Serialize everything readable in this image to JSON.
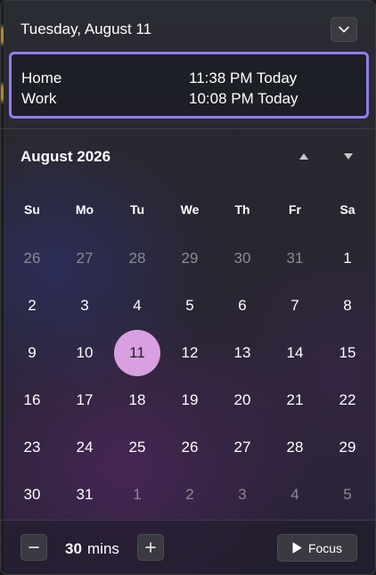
{
  "header": {
    "date": "Tuesday, August 11"
  },
  "clocks": [
    {
      "name": "Home",
      "time": "11:38 PM Today"
    },
    {
      "name": "Work",
      "time": "10:08 PM Today"
    }
  ],
  "calendar": {
    "month_title": "August 2026",
    "weekdays": [
      "Su",
      "Mo",
      "Tu",
      "We",
      "Th",
      "Fr",
      "Sa"
    ],
    "weeks": [
      [
        {
          "d": "26",
          "m": true
        },
        {
          "d": "27",
          "m": true
        },
        {
          "d": "28",
          "m": true
        },
        {
          "d": "29",
          "m": true
        },
        {
          "d": "30",
          "m": true
        },
        {
          "d": "31",
          "m": true
        },
        {
          "d": "1"
        }
      ],
      [
        {
          "d": "2"
        },
        {
          "d": "3"
        },
        {
          "d": "4"
        },
        {
          "d": "5"
        },
        {
          "d": "6"
        },
        {
          "d": "7"
        },
        {
          "d": "8"
        }
      ],
      [
        {
          "d": "9"
        },
        {
          "d": "10"
        },
        {
          "d": "11",
          "today": true
        },
        {
          "d": "12"
        },
        {
          "d": "13"
        },
        {
          "d": "14"
        },
        {
          "d": "15"
        }
      ],
      [
        {
          "d": "16"
        },
        {
          "d": "17"
        },
        {
          "d": "18"
        },
        {
          "d": "19"
        },
        {
          "d": "20"
        },
        {
          "d": "21"
        },
        {
          "d": "22"
        }
      ],
      [
        {
          "d": "23"
        },
        {
          "d": "24"
        },
        {
          "d": "25"
        },
        {
          "d": "26"
        },
        {
          "d": "27"
        },
        {
          "d": "28"
        },
        {
          "d": "29"
        }
      ],
      [
        {
          "d": "30"
        },
        {
          "d": "31"
        },
        {
          "d": "1",
          "m": true
        },
        {
          "d": "2",
          "m": true
        },
        {
          "d": "3",
          "m": true
        },
        {
          "d": "4",
          "m": true
        },
        {
          "d": "5",
          "m": true
        }
      ]
    ]
  },
  "focus": {
    "minutes": "30",
    "unit": "mins",
    "button_label": "Focus"
  },
  "colors": {
    "accent_border": "#8f7df0",
    "today_fill": "#d8a0e0"
  },
  "icons": {
    "collapse": "chevron-down-icon",
    "prev": "triangle-up-icon",
    "next": "triangle-down-icon",
    "decrease": "minus-icon",
    "increase": "plus-icon",
    "focus": "play-icon"
  }
}
